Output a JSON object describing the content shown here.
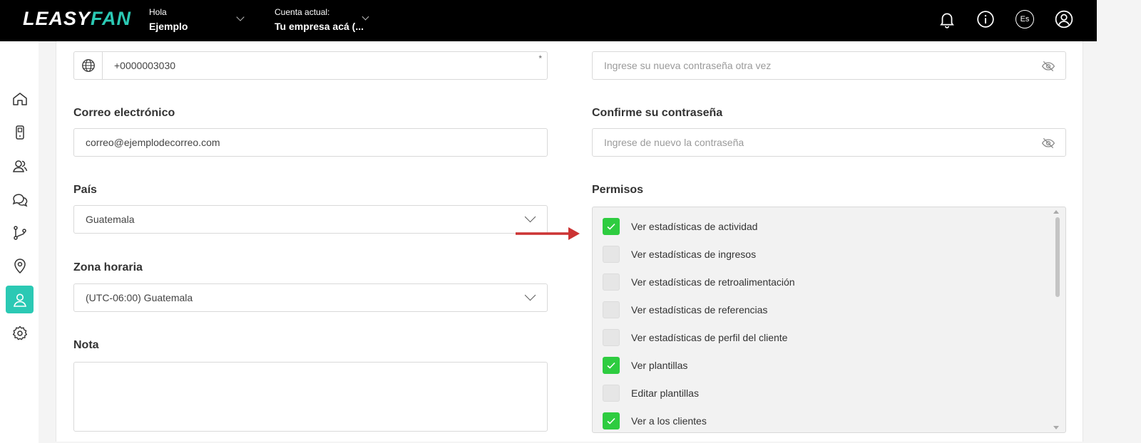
{
  "header": {
    "logo_part1": "LEASY",
    "logo_part2": "FAN",
    "greeting_small": "Hola",
    "greeting_name": "Ejemplo",
    "account_small": "Cuenta actual:",
    "account_name": "Tu empresa acá (...",
    "icons": [
      "bell-icon",
      "info-icon",
      "language-icon",
      "user-profile-icon"
    ],
    "language_code": "Es"
  },
  "sidebar": {
    "items": [
      {
        "icon": "home-icon",
        "active": false
      },
      {
        "icon": "device-icon",
        "active": false
      },
      {
        "icon": "contacts-icon",
        "active": false
      },
      {
        "icon": "chat-icon",
        "active": false
      },
      {
        "icon": "flow-icon",
        "active": false
      },
      {
        "icon": "location-pin-icon",
        "active": false
      },
      {
        "icon": "user-icon",
        "active": true
      },
      {
        "icon": "settings-icon",
        "active": false
      }
    ],
    "accent_color": "#2bc9b4"
  },
  "form": {
    "phone_value": "+0000003030",
    "phone_required_mark": "*",
    "email_label": "Correo electrónico",
    "email_value": "correo@ejemplodecorreo.com",
    "country_label": "País",
    "country_value": "Guatemala",
    "timezone_label": "Zona horaria",
    "timezone_value": "(UTC-06:00) Guatemala",
    "note_label": "Nota",
    "new_password_placeholder": "Ingrese su nueva contraseña otra vez",
    "confirm_label": "Confirme su contraseña",
    "confirm_placeholder": "Ingrese de nuevo la contraseña",
    "permissions_label": "Permisos"
  },
  "permissions": [
    {
      "label": "Ver estadísticas de actividad",
      "checked": true
    },
    {
      "label": "Ver estadísticas de ingresos",
      "checked": false
    },
    {
      "label": "Ver estadísticas de retroalimentación",
      "checked": false
    },
    {
      "label": "Ver estadísticas de referencias",
      "checked": false
    },
    {
      "label": "Ver estadísticas de perfil del cliente",
      "checked": false
    },
    {
      "label": "Ver plantillas",
      "checked": true
    },
    {
      "label": "Editar plantillas",
      "checked": false
    },
    {
      "label": "Ver a los clientes",
      "checked": true
    }
  ],
  "colors": {
    "checkbox_on": "#2ecc40",
    "annotation_arrow": "#cc3333"
  }
}
